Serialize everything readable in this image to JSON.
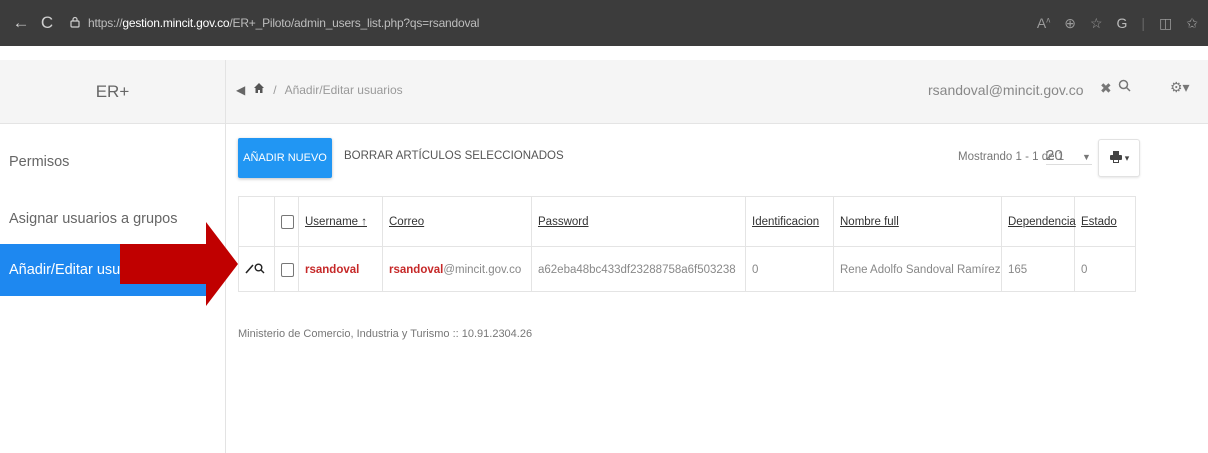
{
  "browser": {
    "back_icon": "←",
    "reload_icon": "C",
    "url_scheme": "https://",
    "url_host": "gestion.mincit.gov.co",
    "url_path": "/ER+_Piloto/admin_users_list.php?qs=rsandoval"
  },
  "header": {
    "brand": "ER+",
    "breadcrumb_current": "Añadir/Editar usuarios",
    "user_search_value": "rsandoval@mincit.gov.co"
  },
  "sidebar": {
    "items": [
      {
        "label": "Permisos"
      },
      {
        "label": "Asignar usuarios a grupos"
      },
      {
        "label": "Añadir/Editar usua"
      }
    ]
  },
  "toolbar": {
    "add_label": "AÑADIR NUEVO",
    "delete_label": "BORRAR ARTÍCULOS SELECCIONADOS",
    "showing_label": "Mostrando 1 - 1 de 1",
    "page_size": "20"
  },
  "table": {
    "columns": [
      "Username ↑",
      "Correo",
      "Password",
      "Identificacion",
      "Nombre full",
      "Dependencia",
      "Estado"
    ],
    "rows": [
      {
        "username": "rsandoval",
        "correo_highlight": "rsandoval",
        "correo_rest": "@mincit.gov.co",
        "password": "a62eba48bc433df23288758a6f503238",
        "identificacion": "0",
        "nombre_full": "Rene Adolfo Sandoval Ramírez",
        "dependencia": "165",
        "estado": "0"
      }
    ]
  },
  "footer": {
    "text": "Ministerio de Comercio, Industria y Turismo :: 10.91.2304.26"
  },
  "colors": {
    "accent": "#2196f3",
    "sidebar_active": "#1e88f0",
    "highlight_text": "#c62828",
    "arrow": "#c00000"
  }
}
